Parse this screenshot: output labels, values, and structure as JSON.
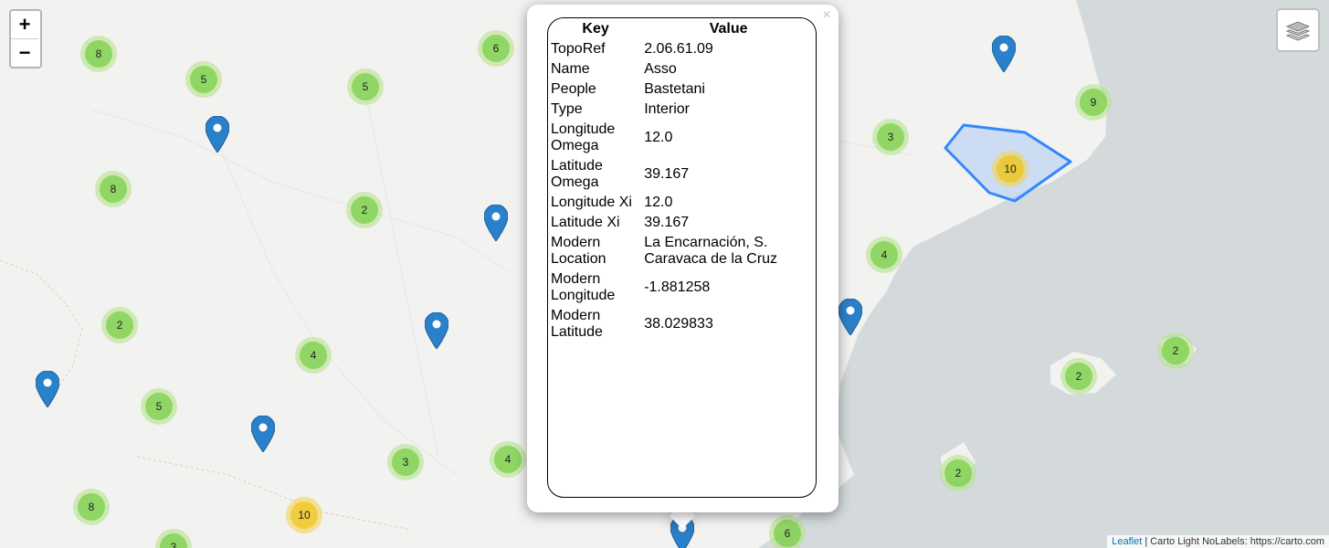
{
  "zoom": {
    "in_label": "+",
    "out_label": "−"
  },
  "attribution": {
    "link": "Leaflet",
    "text": " | Carto Light NoLabels: https://carto.com"
  },
  "popup": {
    "close_label": "×",
    "header_key": "Key",
    "header_value": "Value",
    "rows": [
      {
        "key": "TopoRef",
        "value": "2.06.61.09"
      },
      {
        "key": "Name",
        "value": "Asso"
      },
      {
        "key": "People",
        "value": "Bastetani"
      },
      {
        "key": "Type",
        "value": "Interior"
      },
      {
        "key": "Longitude Omega",
        "value": "12.0"
      },
      {
        "key": "Latitude Omega",
        "value": "39.167"
      },
      {
        "key": "Longitude Xi",
        "value": "12.0"
      },
      {
        "key": "Latitude Xi",
        "value": "39.167"
      },
      {
        "key": "Modern Location",
        "value": "La Encarnación, S. Caravaca de la Cruz"
      },
      {
        "key": "Modern Longitude",
        "value": "-1.881258"
      },
      {
        "key": "Modern Latitude",
        "value": "38.029833"
      }
    ]
  },
  "clusters": [
    {
      "count": "8",
      "size": "small"
    },
    {
      "count": "5",
      "size": "small"
    },
    {
      "count": "5",
      "size": "small"
    },
    {
      "count": "6",
      "size": "small"
    },
    {
      "count": "8",
      "size": "small"
    },
    {
      "count": "2",
      "size": "small"
    },
    {
      "count": "2",
      "size": "small"
    },
    {
      "count": "4",
      "size": "small"
    },
    {
      "count": "5",
      "size": "small"
    },
    {
      "count": "8",
      "size": "small"
    },
    {
      "count": "3",
      "size": "small"
    },
    {
      "count": "4",
      "size": "small"
    },
    {
      "count": "10",
      "size": "medium"
    },
    {
      "count": "3",
      "size": "small"
    },
    {
      "count": "6",
      "size": "small"
    },
    {
      "count": "3",
      "size": "small"
    },
    {
      "count": "4",
      "size": "small"
    },
    {
      "count": "9",
      "size": "small"
    },
    {
      "count": "10",
      "size": "medium"
    },
    {
      "count": "2",
      "size": "small"
    },
    {
      "count": "2",
      "size": "small"
    },
    {
      "count": "2",
      "size": "small"
    }
  ],
  "colors": {
    "cluster_small": "#6ecc39",
    "cluster_medium": "#f0c20c",
    "marker": "#2a81cb",
    "polygon": "#3388ff",
    "sea": "#d4dadc",
    "land": "#f2f2f0"
  }
}
